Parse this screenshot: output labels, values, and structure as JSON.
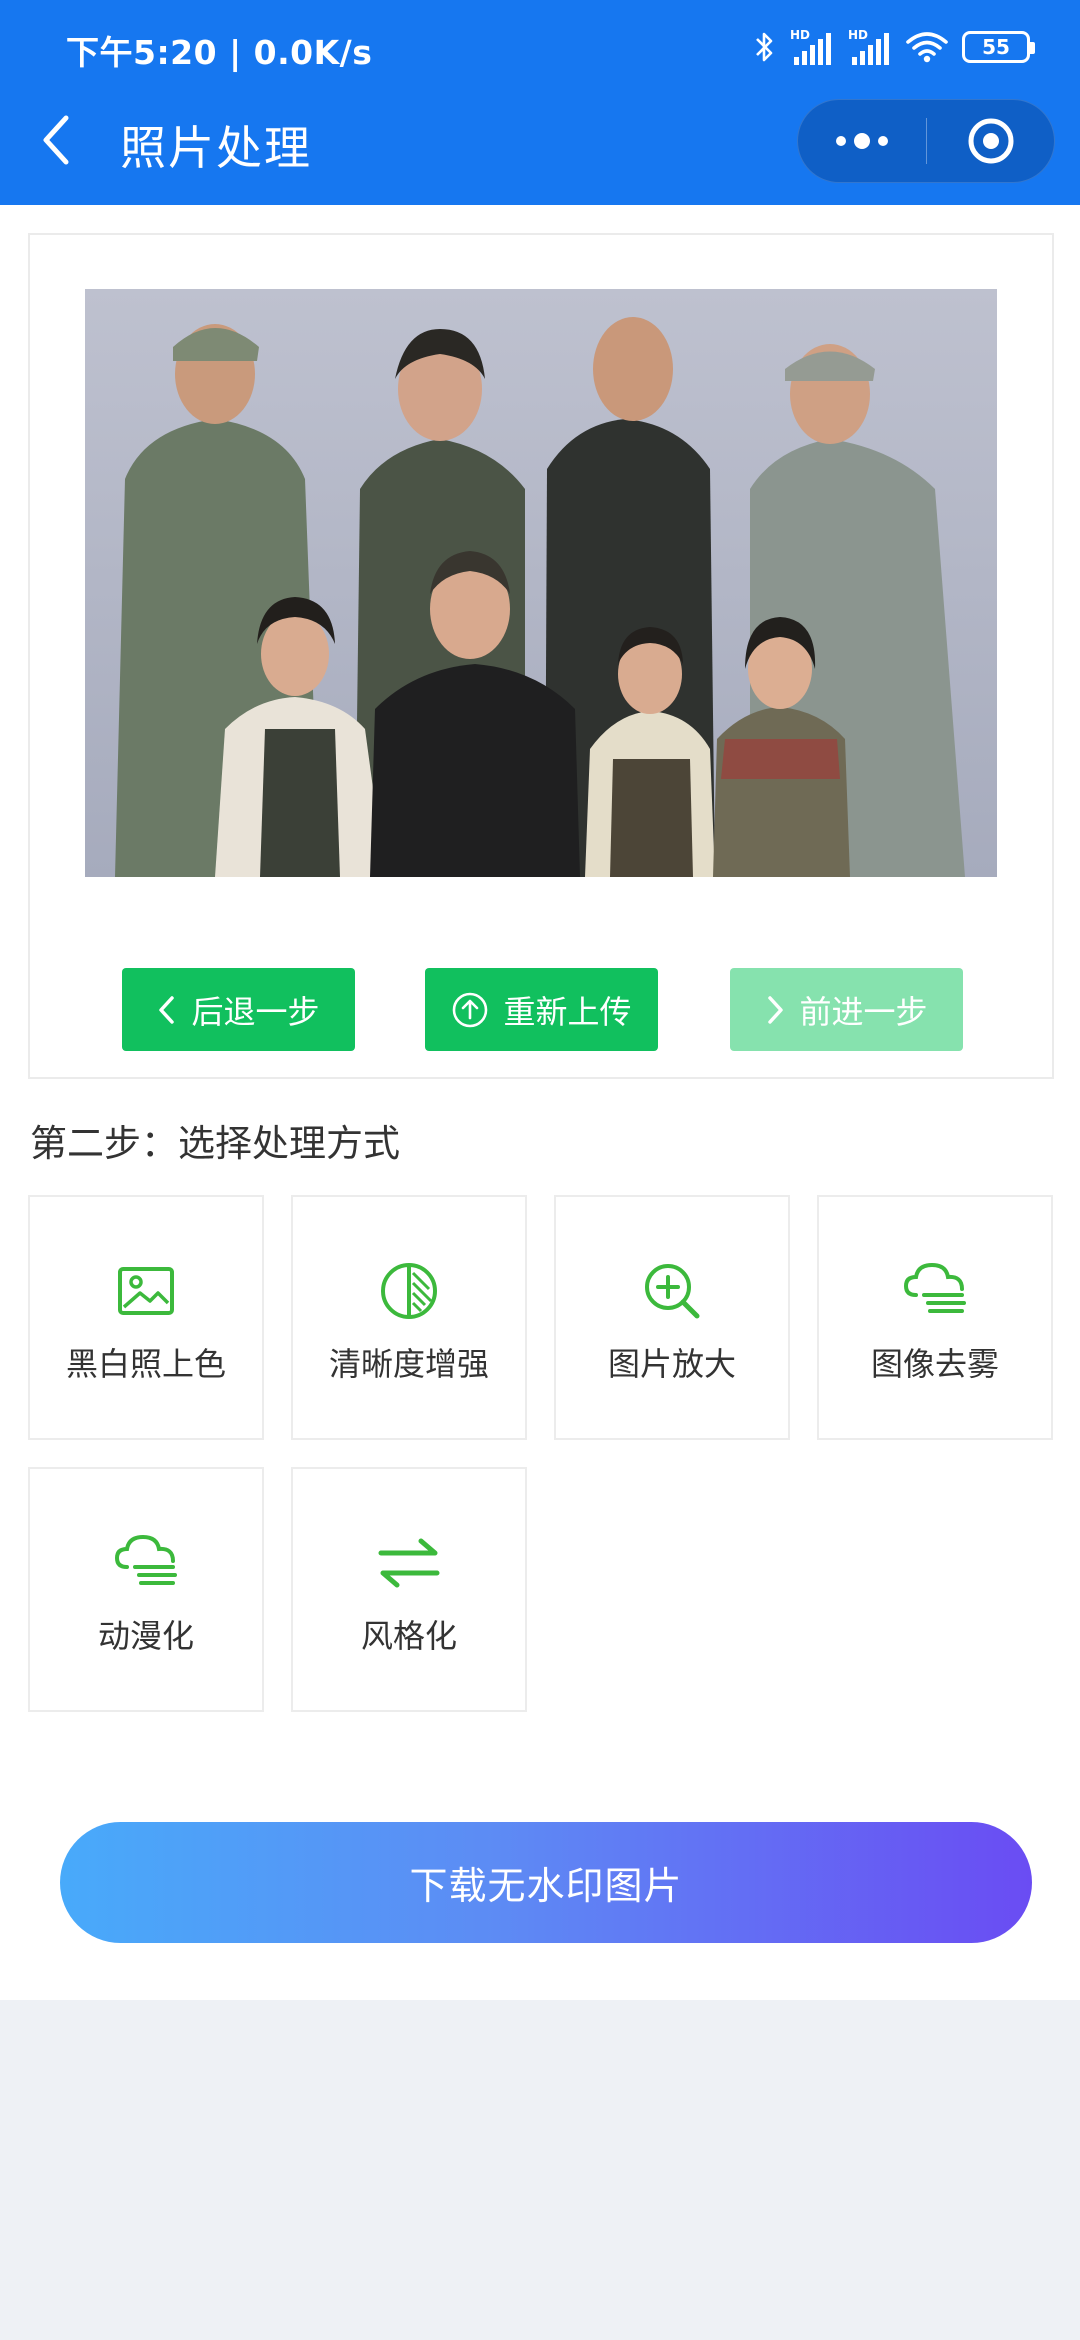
{
  "status_bar": {
    "time": "下午5:20 | 0.0K/s",
    "battery": "55",
    "icons": [
      "bluetooth-icon",
      "signal-hd-icon",
      "signal-hd-icon",
      "wifi-icon",
      "battery-icon"
    ]
  },
  "nav": {
    "title": "照片处理",
    "back_icon": "chevron-left-icon",
    "more_icon": "more-dots-icon",
    "close_icon": "target-circle-icon"
  },
  "photo": {
    "description_icon": "family-photo"
  },
  "actions": {
    "back_label": "后退一步",
    "reupload_label": "重新上传",
    "forward_label": "前进一步"
  },
  "section": {
    "title": "第二步：选择处理方式"
  },
  "tools": [
    {
      "label": "黑白照上色",
      "icon": "image-icon"
    },
    {
      "label": "清晰度增强",
      "icon": "contrast-icon"
    },
    {
      "label": "图片放大",
      "icon": "zoom-in-icon"
    },
    {
      "label": "图像去雾",
      "icon": "cloud-fog-icon"
    },
    {
      "label": "动漫化",
      "icon": "cloud-fog-icon"
    },
    {
      "label": "风格化",
      "icon": "swap-arrows-icon"
    }
  ],
  "download": {
    "label": "下载无水印图片"
  },
  "colors": {
    "header": "#1677f0",
    "green": "#11c05e",
    "green_disabled": "#86e2ae",
    "icon_green": "#3cb93c",
    "gradient_start": "#48aafa",
    "gradient_end": "#6a4cf3"
  }
}
